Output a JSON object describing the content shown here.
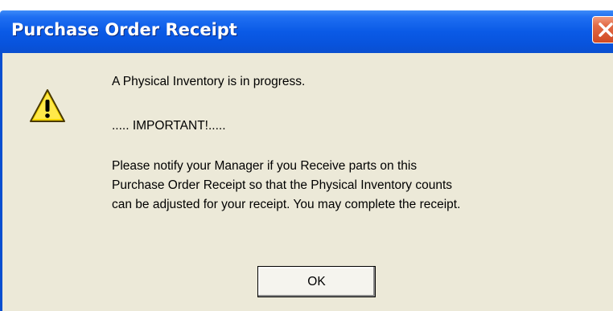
{
  "window": {
    "title": "Purchase Order Receipt",
    "close_icon": "close-icon"
  },
  "dialog": {
    "icon": "warning-icon",
    "line1": "A Physical Inventory is in progress.",
    "important": "..... IMPORTANT!.....",
    "body_lines": [
      "Please notify your Manager if you Receive parts on this",
      "Purchase Order Receipt so that the Physical Inventory counts",
      "can be adjusted for your receipt.  You may complete the receipt."
    ],
    "ok_label": "OK"
  },
  "colors": {
    "titlebar": "#0a5ae6",
    "body": "#ece9d8",
    "close_button": "#d04a24",
    "warning": "#f5d400"
  }
}
